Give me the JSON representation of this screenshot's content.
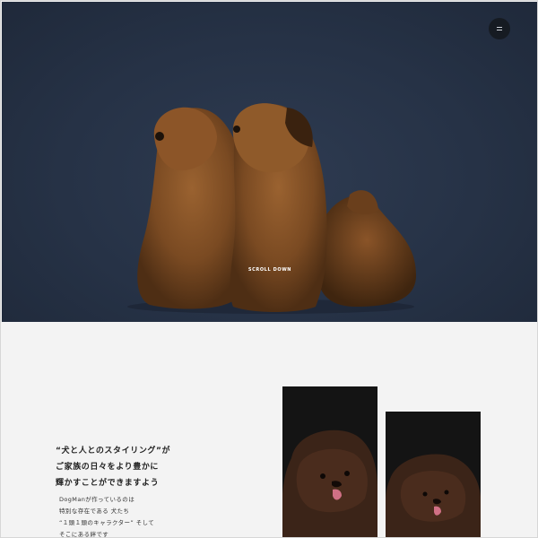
{
  "hero": {
    "scroll_label": "SCROLL DOWN",
    "menu_icon": "hamburger-icon",
    "bg_color": "#263246"
  },
  "intro": {
    "headline": [
      "“犬と人とのスタイリング”が",
      "ご家族の日々をより豊かに",
      "輝かすことができますよう"
    ],
    "body": [
      "DogManが作っているのは",
      "特別な存在である 犬たち",
      "“１頭１頭のキャラクター” そして",
      "そこにある絆です"
    ]
  }
}
